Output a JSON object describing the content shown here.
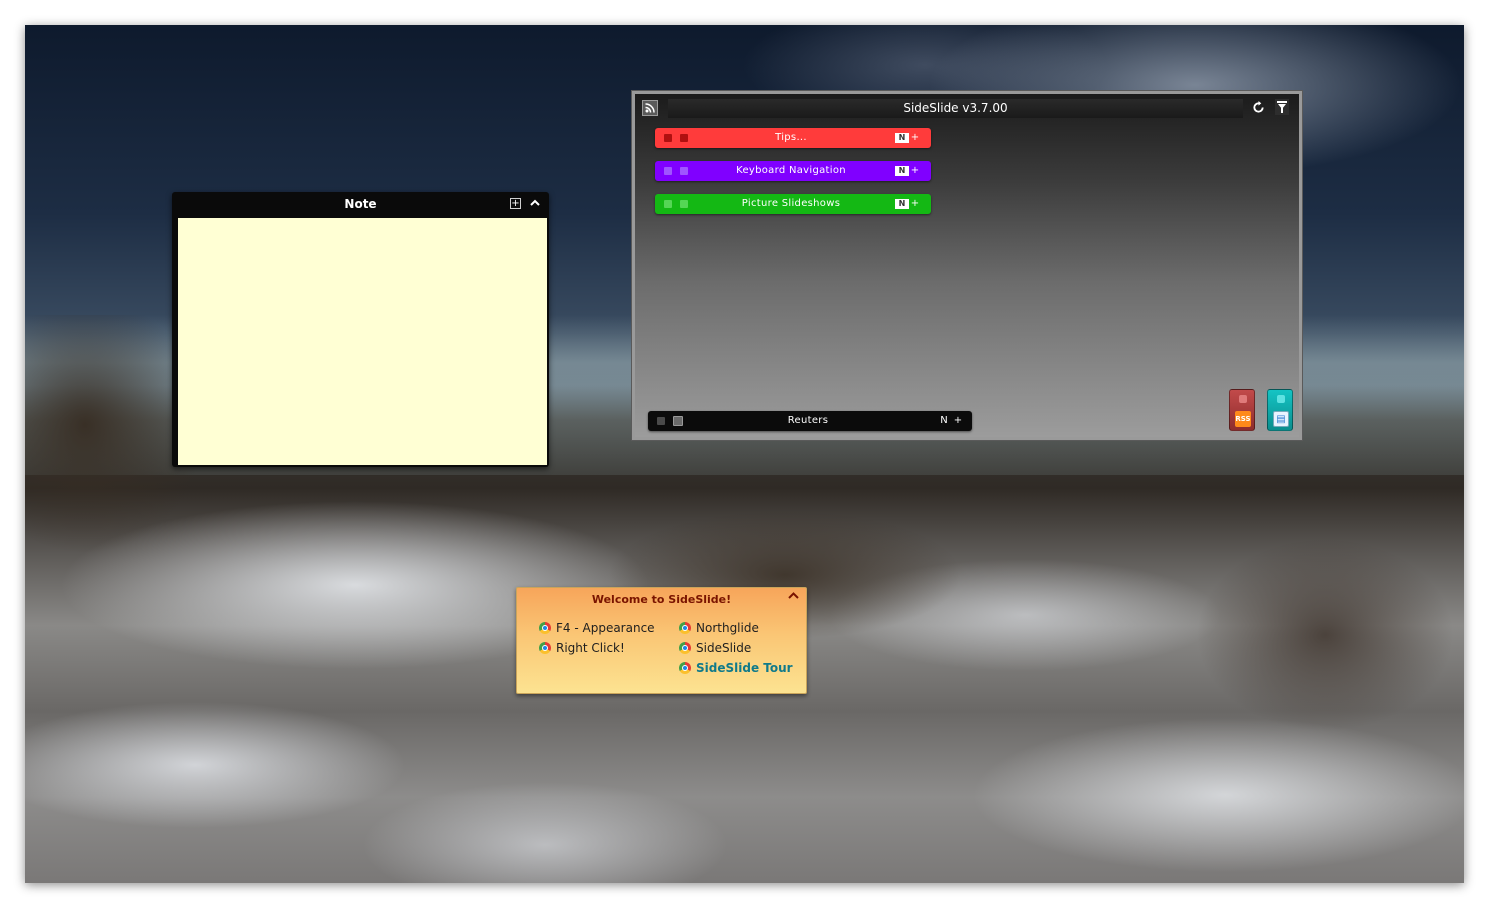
{
  "note": {
    "title": "Note",
    "add_label": "+",
    "collapse_label": "^",
    "body": ""
  },
  "panel": {
    "title": "SideSlide v3.7.00",
    "strips": [
      {
        "label": "Tips...",
        "n_label": "N",
        "plus_label": "+",
        "color": "#ff3b3b"
      },
      {
        "label": "Keyboard Navigation",
        "n_label": "N",
        "plus_label": "+",
        "color": "#8000ff"
      },
      {
        "label": "Picture Slideshows",
        "n_label": "N",
        "plus_label": "+",
        "color": "#14b814"
      }
    ],
    "feed_strip": {
      "label": "Reuters",
      "n_label": "N",
      "plus_label": "+"
    },
    "dock": {
      "rss_label": "RSS",
      "doc_label": "▤"
    }
  },
  "welcome": {
    "title": "Welcome to SideSlide!",
    "collapse_label": "^",
    "links_left": [
      "F4 - Appearance",
      "Right Click!"
    ],
    "links_right": [
      "Northglide",
      "SideSlide",
      "SideSlide Tour"
    ]
  },
  "colors": {
    "note_bg": "#ffffd4",
    "welcome_title": "#7a1400",
    "tour_link": "#107a8a"
  }
}
